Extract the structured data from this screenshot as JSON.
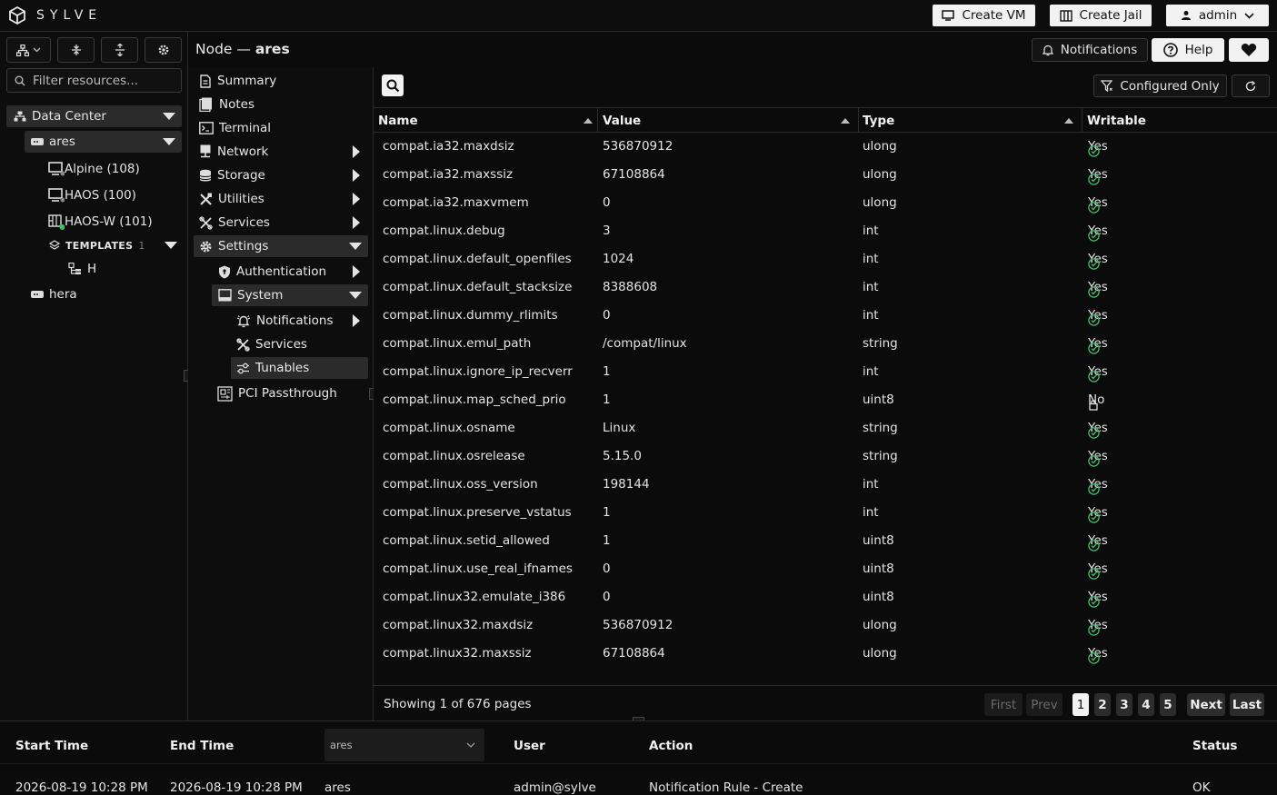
{
  "app": {
    "brand": "SYLVE"
  },
  "header": {
    "create_vm": "Create VM",
    "create_jail": "Create Jail",
    "user": "admin"
  },
  "title_bar": {
    "prefix": "Node —",
    "node": "ares",
    "notifications": "Notifications",
    "help": "Help"
  },
  "tree": {
    "filter_placeholder": "Filter resources...",
    "datacenter": "Data Center",
    "nodes": [
      {
        "label": "ares"
      },
      {
        "label": "hera"
      }
    ],
    "vms": [
      "Alpine (108)",
      "HAOS (100)",
      "HAOS-W (101)"
    ],
    "templates_label": "TEMPLATES",
    "templates_count": "1",
    "template_item": "H"
  },
  "nav": {
    "summary": "Summary",
    "notes": "Notes",
    "terminal": "Terminal",
    "network": "Network",
    "storage": "Storage",
    "utilities": "Utilities",
    "services": "Services",
    "settings": "Settings",
    "authentication": "Authentication",
    "system": "System",
    "notifications": "Notifications",
    "sys_services": "Services",
    "tunables": "Tunables",
    "pci": "PCI Passthrough"
  },
  "toolbar": {
    "configured_only": "Configured Only"
  },
  "table": {
    "columns": {
      "name": "Name",
      "value": "Value",
      "type": "Type",
      "writable": "Writable"
    },
    "rows": [
      {
        "name": "compat.ia32.maxdsiz",
        "value": "536870912",
        "type": "ulong",
        "writable": "Yes"
      },
      {
        "name": "compat.ia32.maxssiz",
        "value": "67108864",
        "type": "ulong",
        "writable": "Yes"
      },
      {
        "name": "compat.ia32.maxvmem",
        "value": "0",
        "type": "ulong",
        "writable": "Yes"
      },
      {
        "name": "compat.linux.debug",
        "value": "3",
        "type": "int",
        "writable": "Yes"
      },
      {
        "name": "compat.linux.default_openfiles",
        "value": "1024",
        "type": "int",
        "writable": "Yes"
      },
      {
        "name": "compat.linux.default_stacksize",
        "value": "8388608",
        "type": "int",
        "writable": "Yes"
      },
      {
        "name": "compat.linux.dummy_rlimits",
        "value": "0",
        "type": "int",
        "writable": "Yes"
      },
      {
        "name": "compat.linux.emul_path",
        "value": "/compat/linux",
        "type": "string",
        "writable": "Yes"
      },
      {
        "name": "compat.linux.ignore_ip_recverr",
        "value": "1",
        "type": "int",
        "writable": "Yes"
      },
      {
        "name": "compat.linux.map_sched_prio",
        "value": "1",
        "type": "uint8",
        "writable": "No"
      },
      {
        "name": "compat.linux.osname",
        "value": "Linux",
        "type": "string",
        "writable": "Yes"
      },
      {
        "name": "compat.linux.osrelease",
        "value": "5.15.0",
        "type": "string",
        "writable": "Yes"
      },
      {
        "name": "compat.linux.oss_version",
        "value": "198144",
        "type": "int",
        "writable": "Yes"
      },
      {
        "name": "compat.linux.preserve_vstatus",
        "value": "1",
        "type": "int",
        "writable": "Yes"
      },
      {
        "name": "compat.linux.setid_allowed",
        "value": "1",
        "type": "uint8",
        "writable": "Yes"
      },
      {
        "name": "compat.linux.use_real_ifnames",
        "value": "0",
        "type": "uint8",
        "writable": "Yes"
      },
      {
        "name": "compat.linux32.emulate_i386",
        "value": "0",
        "type": "uint8",
        "writable": "Yes"
      },
      {
        "name": "compat.linux32.maxdsiz",
        "value": "536870912",
        "type": "ulong",
        "writable": "Yes"
      },
      {
        "name": "compat.linux32.maxssiz",
        "value": "67108864",
        "type": "ulong",
        "writable": "Yes"
      }
    ]
  },
  "pagination": {
    "summary": "Showing 1 of 676 pages",
    "first": "First",
    "prev": "Prev",
    "next": "Next",
    "last": "Last",
    "pages": [
      "1",
      "2",
      "3",
      "4",
      "5"
    ],
    "current": "1"
  },
  "log": {
    "columns": {
      "start": "Start Time",
      "end": "End Time",
      "node_filter": "ares",
      "user": "User",
      "action": "Action",
      "status": "Status"
    },
    "row": {
      "start": "2026-08-19 10:28 PM",
      "end": "2026-08-19 10:28 PM",
      "node": "ares",
      "user": "admin@sylve",
      "action": "Notification Rule - Create",
      "status": "OK"
    }
  },
  "colors": {
    "ok": "#3fbf6a",
    "selected": "#2b2b2b",
    "border": "#2a2a2a"
  }
}
